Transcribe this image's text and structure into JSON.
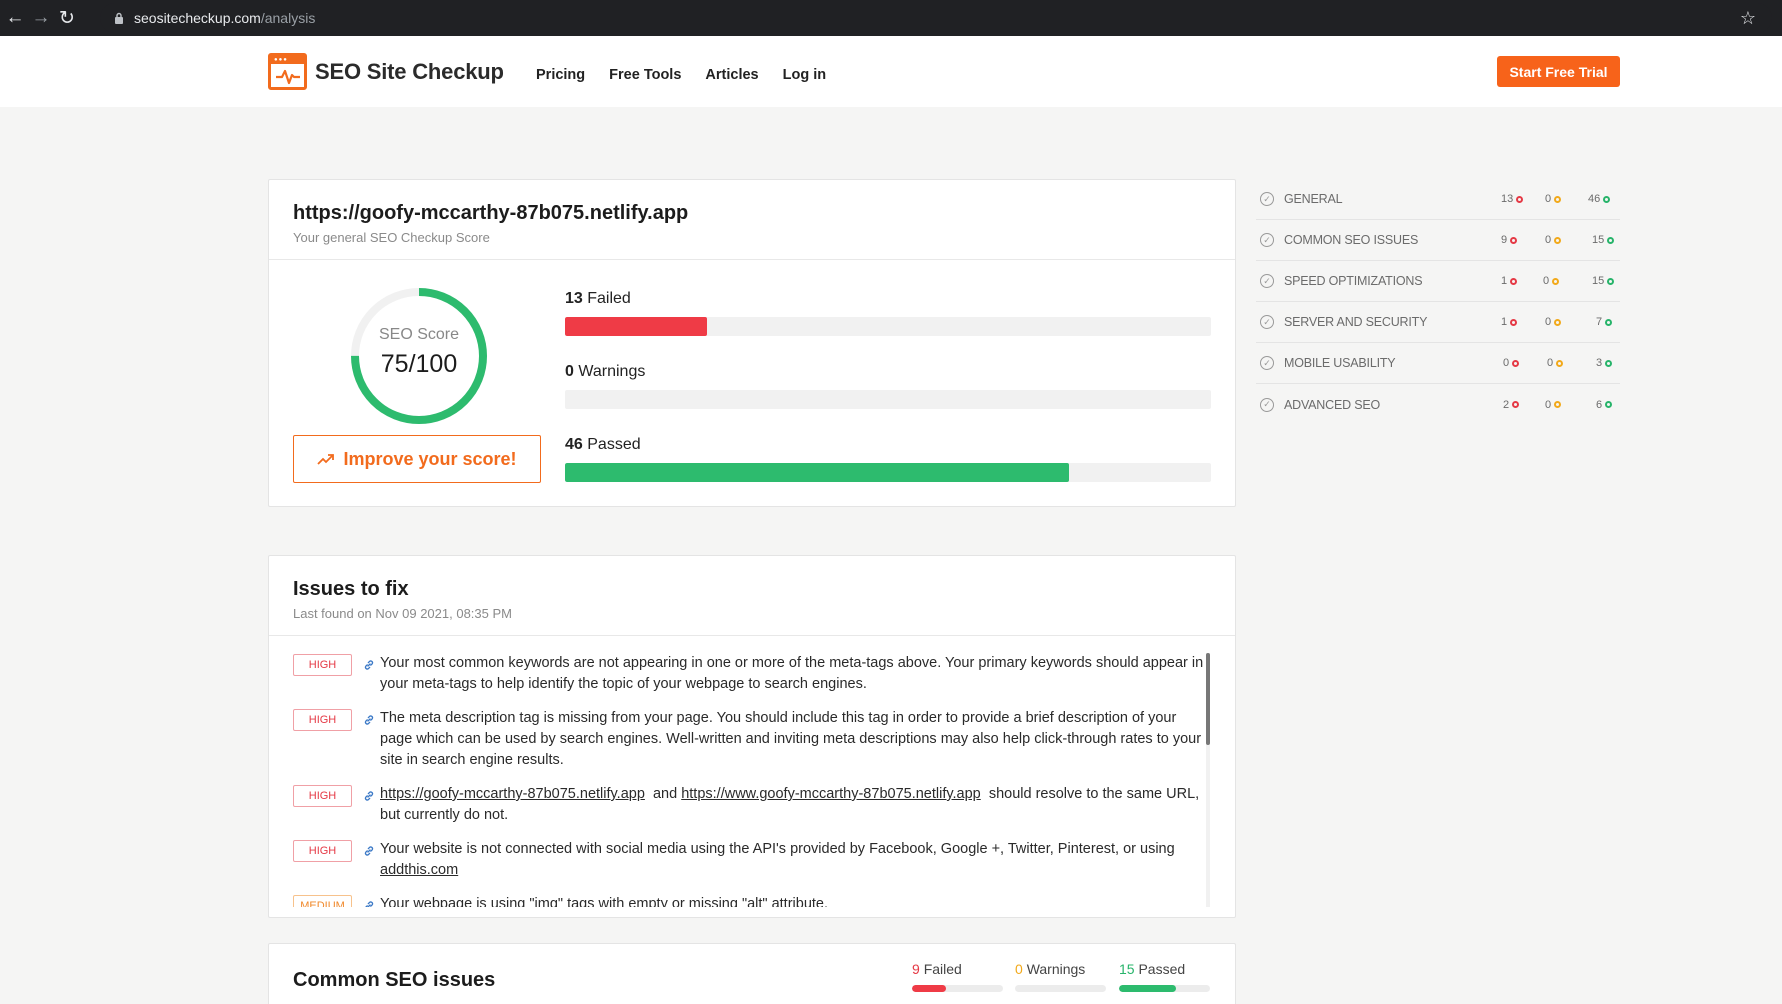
{
  "browser": {
    "url_host": "seositecheckup.com",
    "url_path": "/analysis"
  },
  "site": {
    "brand": "SEO Site Checkup",
    "nav": [
      "Pricing",
      "Free Tools",
      "Articles",
      "Log in"
    ],
    "cta": "Start Free Trial",
    "accent_color": "#f7631a"
  },
  "score_card": {
    "url": "https://goofy-mccarthy-87b075.netlify.app",
    "subtitle": "Your general SEO Checkup Score",
    "gauge_label": "SEO Score",
    "gauge_value": "75/100",
    "score_fraction": 0.75,
    "improve_label": "Improve your score!",
    "stats": [
      {
        "count": "13",
        "label": "Failed",
        "fraction": 0.22,
        "color": "#ef3b46"
      },
      {
        "count": "0",
        "label": "Warnings",
        "fraction": 0,
        "color": "#f2a91a"
      },
      {
        "count": "46",
        "label": "Passed",
        "fraction": 0.78,
        "color": "#2dbb6e"
      }
    ]
  },
  "sidebar": {
    "items": [
      {
        "label": "GENERAL",
        "failed": "13",
        "warnings": "0",
        "passed": "46"
      },
      {
        "label": "COMMON SEO ISSUES",
        "failed": "9",
        "warnings": "0",
        "passed": "15"
      },
      {
        "label": "SPEED OPTIMIZATIONS",
        "failed": "1",
        "warnings": "0",
        "passed": "15"
      },
      {
        "label": "SERVER AND SECURITY",
        "failed": "1",
        "warnings": "0",
        "passed": "7"
      },
      {
        "label": "MOBILE USABILITY",
        "failed": "0",
        "warnings": "0",
        "passed": "3"
      },
      {
        "label": "ADVANCED SEO",
        "failed": "2",
        "warnings": "0",
        "passed": "6"
      }
    ]
  },
  "issues": {
    "title": "Issues to fix",
    "subtitle": "Last found on Nov 09 2021, 08:35 PM",
    "items": [
      {
        "severity": "HIGH",
        "text": "Your most common keywords are not appearing in one or more of the meta-tags above. Your primary keywords should appear in your meta-tags to help identify the topic of your webpage to search engines."
      },
      {
        "severity": "HIGH",
        "text": "The meta description tag is missing from your page. You should include this tag in order to provide a brief description of your page which can be used by search engines. Well-written and inviting meta descriptions may also help click-through rates to your site in search engine results."
      },
      {
        "severity": "HIGH",
        "link1": "https://goofy-mccarthy-87b075.netlify.app",
        "mid": "and",
        "link2": "https://www.goofy-mccarthy-87b075.netlify.app",
        "tail": "should resolve to the same URL, but currently do not."
      },
      {
        "severity": "HIGH",
        "text": "Your website is not connected with social media using the API's provided by Facebook, Google +, Twitter, Pinterest, or using",
        "link": "addthis.com"
      },
      {
        "severity": "MEDIUM",
        "text": "Your webpage is using \"img\" tags with empty or missing \"alt\" attribute."
      }
    ]
  },
  "common_seo": {
    "title": "Common SEO issues",
    "failed": {
      "count": "9",
      "label": "Failed",
      "fraction": 0.375
    },
    "warnings": {
      "count": "0",
      "label": "Warnings",
      "fraction": 0
    },
    "passed": {
      "count": "15",
      "label": "Passed",
      "fraction": 0.625
    }
  }
}
